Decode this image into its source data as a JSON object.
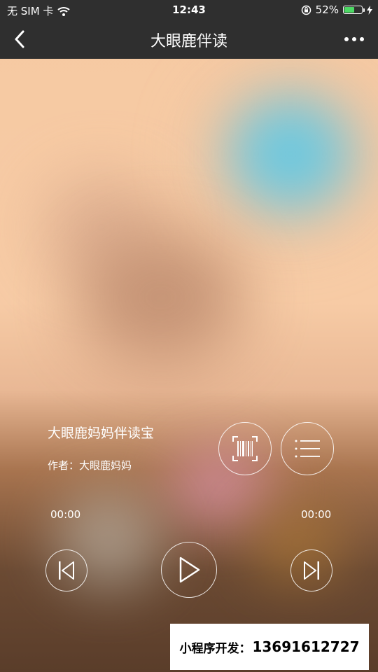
{
  "status_bar": {
    "carrier": "无 SIM 卡",
    "time": "12:43",
    "battery": "52%",
    "battery_level": 0.52
  },
  "nav": {
    "title": "大眼鹿伴读",
    "back_icon": "chevron-left-icon",
    "more_icon": "more-dots-icon"
  },
  "player": {
    "title": "大眼鹿妈妈伴读宝",
    "author_label": "作者：",
    "author": "大眼鹿妈妈",
    "current_time": "00:00",
    "total_time": "00:00",
    "buttons": {
      "scan": "barcode-scan-icon",
      "playlist": "list-icon",
      "previous": "skip-previous-icon",
      "play": "play-icon",
      "next": "skip-next-icon"
    }
  },
  "promo": {
    "label": "小程序开发：",
    "phone": "13691612727"
  },
  "colors": {
    "bar_background": "#2f2f2f",
    "battery_fill": "#4cd964",
    "text": "#ffffff"
  }
}
